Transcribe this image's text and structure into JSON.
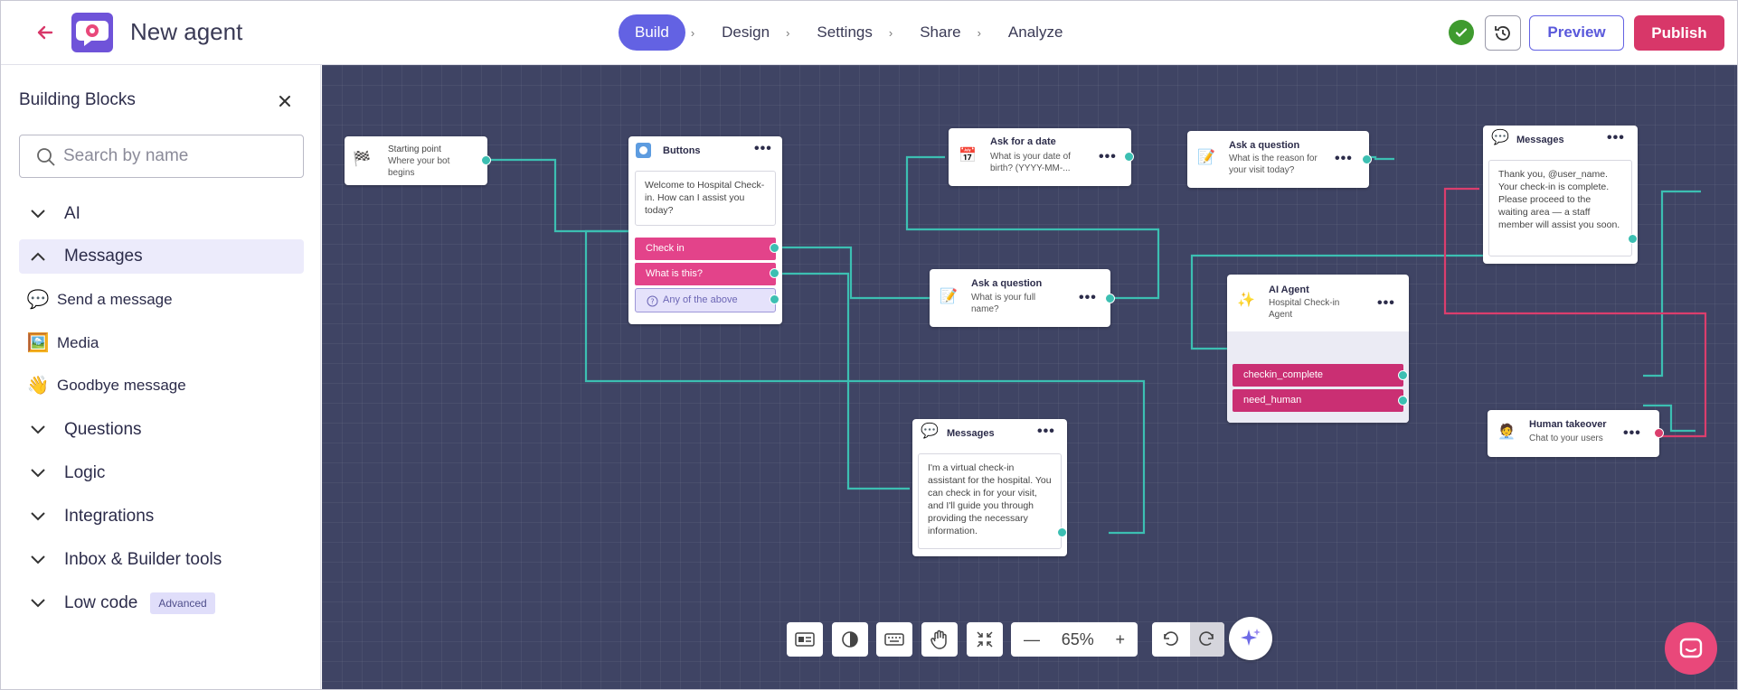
{
  "header": {
    "title": "New agent",
    "steps": [
      "Build",
      "Design",
      "Settings",
      "Share",
      "Analyze"
    ],
    "active_step": "Build",
    "preview": "Preview",
    "publish": "Publish"
  },
  "sidebar": {
    "title": "Building Blocks",
    "search_placeholder": "Search by name",
    "categories": [
      {
        "label": "AI",
        "open": false
      },
      {
        "label": "Messages",
        "open": true
      },
      {
        "label": "Questions",
        "open": false
      },
      {
        "label": "Logic",
        "open": false
      },
      {
        "label": "Integrations",
        "open": false
      },
      {
        "label": "Inbox & Builder tools",
        "open": false
      },
      {
        "label": "Low code",
        "open": false,
        "badge": "Advanced"
      }
    ],
    "message_items": [
      {
        "label": "Send a message",
        "icon": "speech-bubble-icon"
      },
      {
        "label": "Media",
        "icon": "media-icon"
      },
      {
        "label": "Goodbye message",
        "icon": "waving-hand-icon"
      }
    ]
  },
  "nodes": {
    "start": {
      "title": "Starting point",
      "desc": "Where your bot begins"
    },
    "buttons": {
      "title": "Buttons",
      "message": "Welcome to Hospital Check-in. How can I assist you today?",
      "options": [
        "Check in",
        "What is this?"
      ],
      "fallback": "Any of the above"
    },
    "ask_date": {
      "title": "Ask for a date",
      "desc": "What is your date of birth? (YYYY-MM-..."
    },
    "ask_reason": {
      "title": "Ask a question",
      "desc": "What is the reason for your visit today?"
    },
    "ask_name": {
      "title": "Ask a question",
      "desc": "What is your full name?"
    },
    "ai_agent": {
      "title": "AI Agent",
      "desc": "Hospital Check-in Agent",
      "outputs": [
        "checkin_complete",
        "need_human"
      ]
    },
    "msg_end": {
      "title": "Messages",
      "message": "Thank you, @user_name. Your check-in is complete. Please proceed to the waiting area — a staff member will assist you soon."
    },
    "msg_info": {
      "title": "Messages",
      "message": "I'm a virtual check-in assistant for the hospital. You can check in for your visit, and I'll guide you through providing the necessary information."
    },
    "human": {
      "title": "Human takeover",
      "desc": "Chat to your users"
    }
  },
  "toolbar": {
    "zoom": "65%"
  },
  "colors": {
    "accent": "#6362e3",
    "brand": "#d83769",
    "wire": "#3cbfb2",
    "wire_alt": "#db3e6d",
    "canvas": "#3f4464"
  }
}
